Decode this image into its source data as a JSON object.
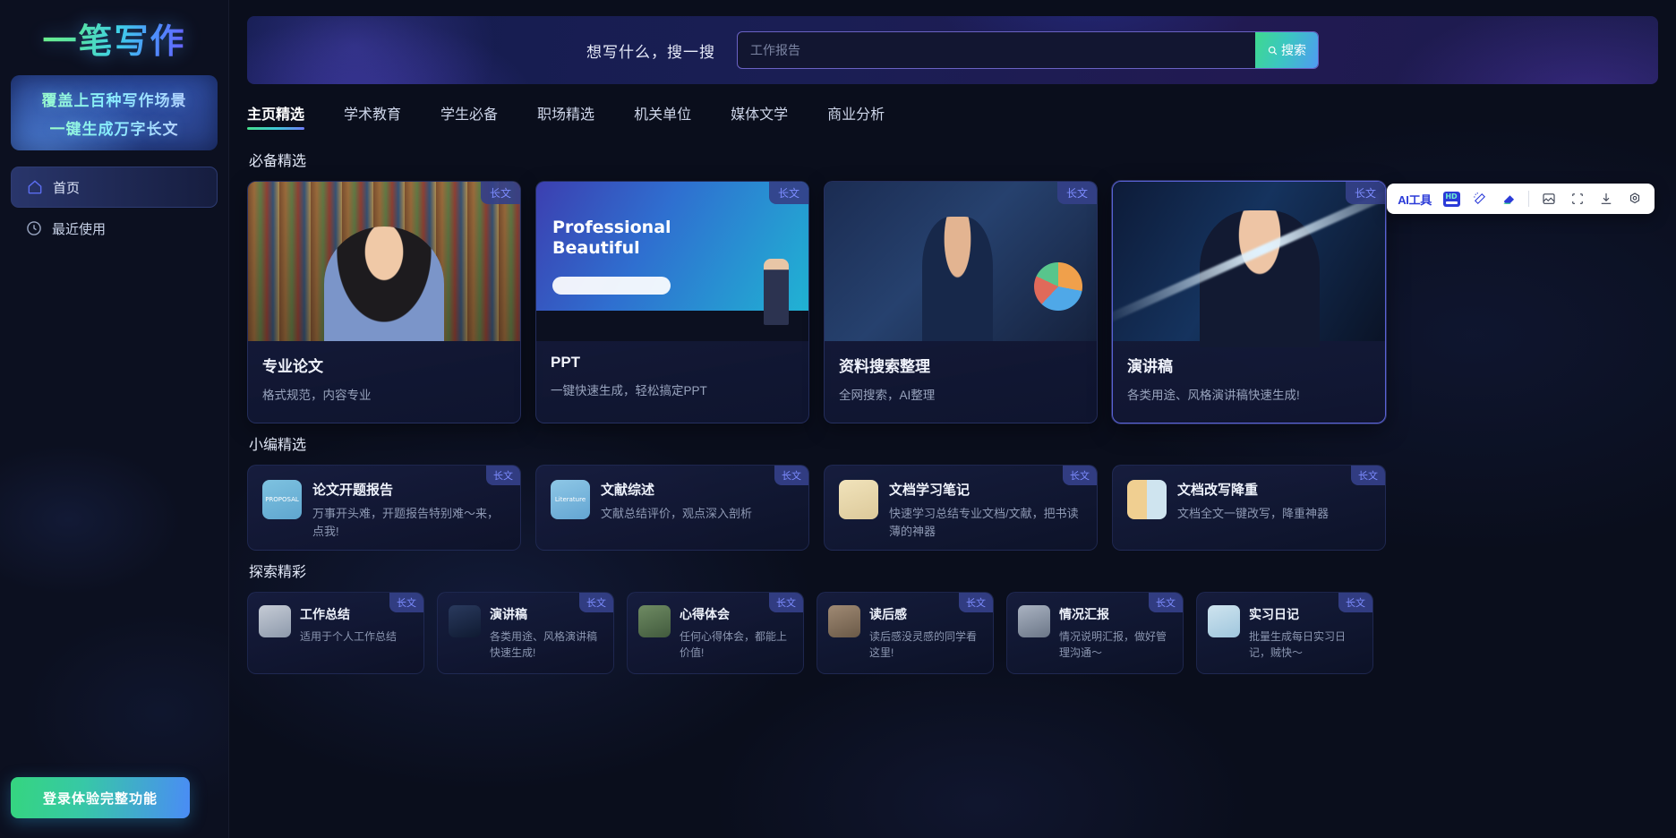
{
  "sidebar": {
    "logo": "一笔写作",
    "promo": {
      "line1": "覆盖上百种写作场景",
      "line2": "一键生成万字长文"
    },
    "nav": [
      {
        "label": "首页",
        "icon": "home-icon",
        "active": true
      },
      {
        "label": "最近使用",
        "icon": "clock-icon",
        "active": false
      }
    ],
    "login_button": "登录体验完整功能"
  },
  "hero": {
    "label": "想写什么，搜一搜",
    "search_placeholder": "工作报告",
    "search_value": "",
    "search_button": "搜索",
    "search_icon": "search-icon"
  },
  "tabs": [
    {
      "label": "主页精选",
      "active": true
    },
    {
      "label": "学术教育",
      "active": false
    },
    {
      "label": "学生必备",
      "active": false
    },
    {
      "label": "职场精选",
      "active": false
    },
    {
      "label": "机关单位",
      "active": false
    },
    {
      "label": "媒体文学",
      "active": false
    },
    {
      "label": "商业分析",
      "active": false
    }
  ],
  "ai_toolbar": {
    "label": "AI工具",
    "buttons": [
      {
        "name": "hd-icon",
        "glyph": "HD"
      },
      {
        "name": "magic-wand-icon",
        "glyph": "✨"
      },
      {
        "name": "eraser-icon",
        "glyph": "◆"
      },
      {
        "name": "image-edit-icon",
        "glyph": "▱"
      },
      {
        "name": "crop-icon",
        "glyph": "⛶"
      },
      {
        "name": "download-icon",
        "glyph": "↧"
      },
      {
        "name": "settings-icon",
        "glyph": "⚙"
      }
    ]
  },
  "sections": [
    {
      "title": "必备精选",
      "layout": "big",
      "cards": [
        {
          "title": "专业论文",
          "desc": "格式规范，内容专业",
          "badge": "长文",
          "thumb": "th-library",
          "featured": false
        },
        {
          "title": "PPT",
          "desc": "一键快速生成，轻松搞定PPT",
          "badge": "长文",
          "thumb": "th-ppt",
          "featured": false
        },
        {
          "title": "资料搜索整理",
          "desc": "全网搜索，AI整理",
          "badge": "长文",
          "thumb": "th-data",
          "featured": false
        },
        {
          "title": "演讲稿",
          "desc": "各类用途、风格演讲稿快速生成!",
          "badge": "长文",
          "thumb": "th-speech",
          "featured": true
        }
      ]
    },
    {
      "title": "小编精选",
      "layout": "mid",
      "cards": [
        {
          "title": "论文开题报告",
          "desc": "万事开头难，开题报告特别难～来，点我!",
          "badge": "长文",
          "icon": "ic-proposal",
          "icon_text": "PROPOSAL"
        },
        {
          "title": "文献综述",
          "desc": "文献总结评价，观点深入剖析",
          "badge": "长文",
          "icon": "ic-literature",
          "icon_text": "Literature"
        },
        {
          "title": "文档学习笔记",
          "desc": "快速学习总结专业文档/文献，把书读薄的神器",
          "badge": "长文",
          "icon": "ic-notes",
          "icon_text": ""
        },
        {
          "title": "文档改写降重",
          "desc": "文档全文一键改写，降重神器",
          "badge": "长文",
          "icon": "ic-rewrite",
          "icon_text": ""
        }
      ]
    },
    {
      "title": "探索精彩",
      "layout": "small",
      "cards": [
        {
          "title": "工作总结",
          "desc": "适用于个人工作总结",
          "badge": "长文",
          "icon": "ic-worksum"
        },
        {
          "title": "演讲稿",
          "desc": "各类用途、风格演讲稿快速生成!",
          "badge": "长文",
          "icon": "ic-speech2"
        },
        {
          "title": "心得体会",
          "desc": "任何心得体会，都能上价值!",
          "badge": "长文",
          "icon": "ic-insight"
        },
        {
          "title": "读后感",
          "desc": "读后感没灵感的同学看这里!",
          "badge": "长文",
          "icon": "ic-reading"
        },
        {
          "title": "情况汇报",
          "desc": "情况说明汇报，做好管理沟通～",
          "badge": "长文",
          "icon": "ic-report"
        },
        {
          "title": "实习日记",
          "desc": "批量生成每日实习日记，贼快～",
          "badge": "长文",
          "icon": "ic-diary"
        }
      ]
    }
  ]
}
